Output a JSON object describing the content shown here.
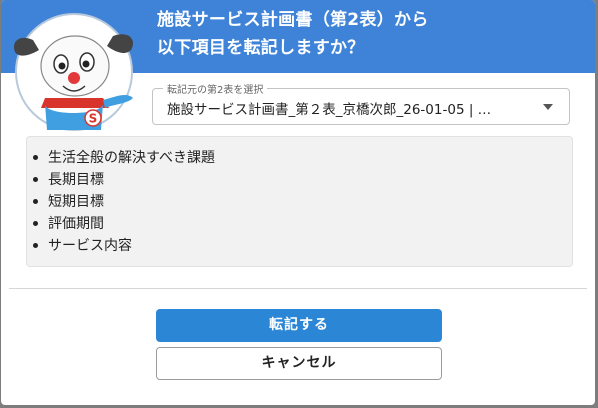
{
  "dialog": {
    "title_line1": "施設サービス計画書（第2表）から",
    "title_line2": "以下項目を転記しますか？"
  },
  "select": {
    "label": "転記元の第2表を選択",
    "value": "施設サービス計画書_第２表_京橋次郎_26-01-05 | …"
  },
  "items": [
    "生活全般の解決すべき課題",
    "長期目標",
    "短期目標",
    "評価期間",
    "サービス内容"
  ],
  "buttons": {
    "confirm": "転記する",
    "cancel": "キャンセル"
  },
  "colors": {
    "header": "#3f83d8",
    "primary_button": "#2c86d6"
  }
}
